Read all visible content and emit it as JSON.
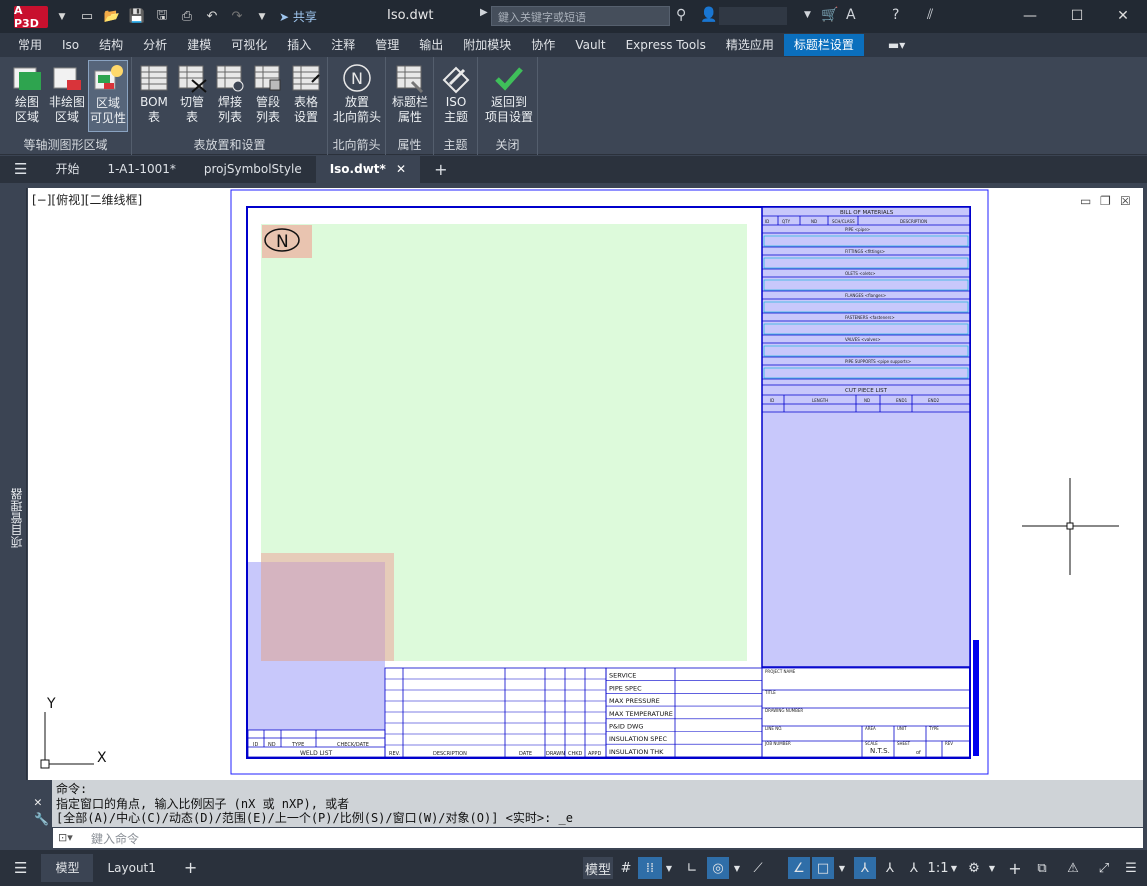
{
  "app": {
    "logo": "A P3D",
    "title": "Iso.dwt",
    "share_label": "共享",
    "search_placeholder": "鍵入关键字或短语"
  },
  "ribbon_tabs": [
    "常用",
    "Iso",
    "结构",
    "分析",
    "建模",
    "可视化",
    "插入",
    "注释",
    "管理",
    "输出",
    "附加模块",
    "协作",
    "Vault",
    "Express Tools",
    "精选应用",
    "标题栏设置"
  ],
  "active_ribbon_tab": "标题栏设置",
  "panels": [
    {
      "title": "等轴测图形区域",
      "tools": [
        {
          "label": "绘图\n区域",
          "icon": "draw-area-icon"
        },
        {
          "label": "非绘图\n区域",
          "icon": "non-draw-area-icon"
        },
        {
          "label": "区域\n可见性",
          "icon": "area-visibility-icon",
          "selected": true
        }
      ]
    },
    {
      "title": "表放置和设置",
      "tools": [
        {
          "label": "BOM\n表",
          "icon": "bom-table-icon"
        },
        {
          "label": "切管\n表",
          "icon": "cut-pipe-table-icon"
        },
        {
          "label": "焊接\n列表",
          "icon": "weld-list-icon"
        },
        {
          "label": "管段\n列表",
          "icon": "spool-list-icon"
        },
        {
          "label": "表格\n设置",
          "icon": "table-settings-icon"
        }
      ]
    },
    {
      "title": "北向箭头",
      "tools": [
        {
          "label": "放置\n北向箭头",
          "icon": "north-arrow-icon"
        }
      ]
    },
    {
      "title": "属性",
      "tools": [
        {
          "label": "标题栏\n属性",
          "icon": "titleblock-props-icon"
        }
      ]
    },
    {
      "title": "主题",
      "tools": [
        {
          "label": "ISO\n主题",
          "icon": "iso-theme-icon"
        }
      ]
    },
    {
      "title": "关闭",
      "tools": [
        {
          "label": "返回到\n项目设置",
          "icon": "return-checkmark-icon"
        }
      ]
    }
  ],
  "file_tabs": [
    "开始",
    "1-A1-1001*",
    "projSymbolStyle",
    "Iso.dwt*"
  ],
  "active_file_tab": "Iso.dwt*",
  "side_panel_label": "项目管理器",
  "viewport_label": "[−][俯视][二维线框]",
  "drawing": {
    "north_letter": "N",
    "bom_title": "BILL OF MATERIALS",
    "bom_headers": [
      "ID",
      "QTY",
      "ND",
      "SCH/CLASS",
      "DESCRIPTION"
    ],
    "bom_sections": [
      "PIPE <pipe>",
      "FITTINGS <fittings>",
      "OLETS <olets>",
      "FLANGES <flanges>",
      "FASTENERS <fasteners>",
      "VALVES <valves>",
      "PIPE SUPPORTS <pipe supports>"
    ],
    "cut_title": "CUT PIECE LIST",
    "cut_headers": [
      "ID",
      "LENGTH",
      "ND",
      "END1",
      "END2"
    ],
    "weld_headers": [
      "ID",
      "ND",
      "TYPE",
      "CHECK/DATE"
    ],
    "weld_title": "WELD LIST",
    "rev_headers": [
      "REV.",
      "DESCRIPTION",
      "DATE",
      "DRAWN",
      "CHKD",
      "APPD"
    ],
    "spec_rows": [
      "SERVICE",
      "PIPE SPEC",
      "MAX PRESSURE",
      "MAX TEMPERATURE",
      "P&ID DWG",
      "INSULATION SPEC",
      "INSULATION THK"
    ],
    "title_fields": [
      "PROJECT NAME",
      "TITLE",
      "DRAWING NUMBER",
      "LINE NO.",
      "AREA",
      "UNIT",
      "TYPE",
      "JOB NUMBER",
      "SCALE",
      "SHEET",
      "REV"
    ],
    "scale_value": "N.T.S.",
    "sheet_value": "of"
  },
  "ucs": {
    "x": "X",
    "y": "Y"
  },
  "command": {
    "lines": [
      "命令:",
      "指定窗口的角点, 输入比例因子 (nX 或 nXP), 或者",
      "[全部(A)/中心(C)/动态(D)/范围(E)/上一个(P)/比例(S)/窗口(W)/对象(O)] <实时>: _e"
    ],
    "placeholder": "鍵入命令"
  },
  "layout_tabs": [
    "模型",
    "Layout1"
  ],
  "active_layout_tab": "模型",
  "status": {
    "model_label": "模型",
    "scale": "1:1"
  }
}
